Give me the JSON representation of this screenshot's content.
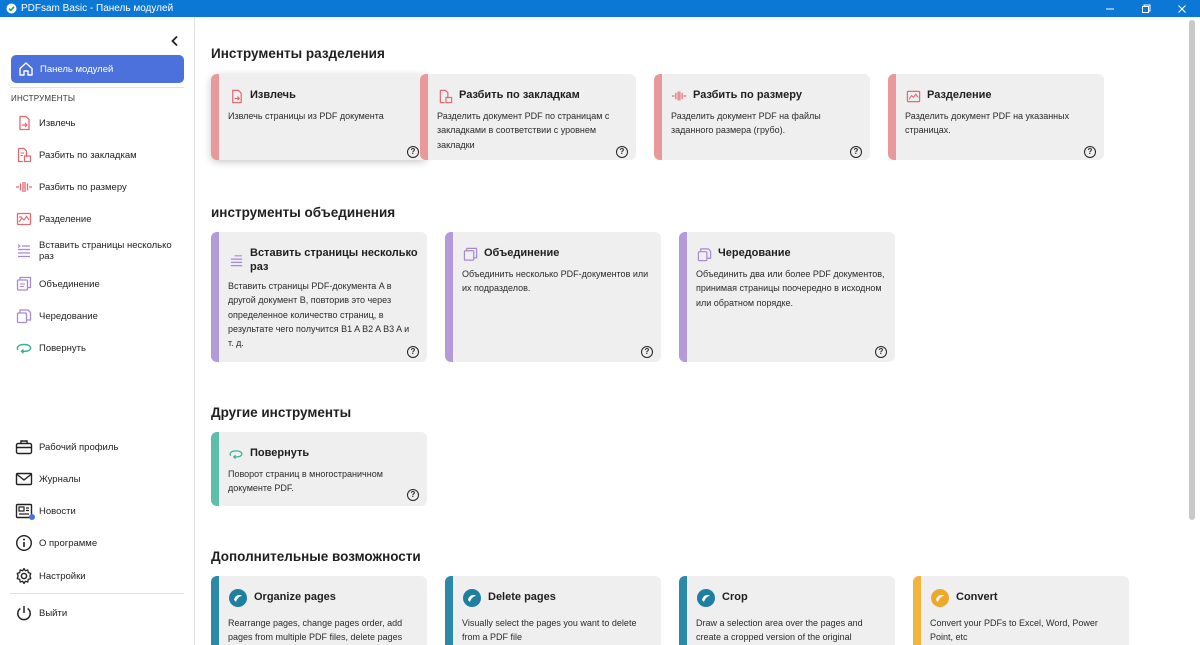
{
  "window": {
    "title": "PDFsam Basic - Панель модулей"
  },
  "sidebar": {
    "dashboard_label": "Панель модулей",
    "section_label": "ИНСТРУМЕНТЫ",
    "tools": [
      {
        "label": "Извлечь",
        "icon": "extract-icon"
      },
      {
        "label": "Разбить по закладкам",
        "icon": "split-bookmarks-icon"
      },
      {
        "label": "Разбить по размеру",
        "icon": "split-size-icon"
      },
      {
        "label": "Разделение",
        "icon": "split-icon"
      },
      {
        "label": "Вставить страницы несколько раз",
        "icon": "insert-pages-icon"
      },
      {
        "label": "Объединение",
        "icon": "merge-icon"
      },
      {
        "label": "Чередование",
        "icon": "alternate-mix-icon"
      },
      {
        "label": "Повернуть",
        "icon": "rotate-icon"
      }
    ],
    "bottom": [
      {
        "label": "Рабочий профиль",
        "icon": "workspace-icon"
      },
      {
        "label": "Журналы",
        "icon": "logs-icon"
      },
      {
        "label": "Новости",
        "icon": "news-icon"
      },
      {
        "label": "О программе",
        "icon": "info-icon"
      },
      {
        "label": "Настройки",
        "icon": "settings-icon"
      }
    ],
    "exit_label": "Выйти"
  },
  "sections": {
    "split": {
      "title": "Инструменты разделения",
      "cards": [
        {
          "title": "Извлечь",
          "desc": "Извлечь страницы из PDF документа"
        },
        {
          "title": "Разбить по закладкам",
          "desc": "Разделить документ PDF по страницам с закладками в соответствии с уровнем закладки"
        },
        {
          "title": "Разбить по размеру",
          "desc": "Разделить документ PDF на файлы заданного размера (грубо)."
        },
        {
          "title": "Разделение",
          "desc": "Разделить документ PDF на указанных страницах."
        }
      ]
    },
    "merge": {
      "title": "инструменты объединения",
      "cards": [
        {
          "title": "Вставить страницы несколько раз",
          "desc": "Вставить страницы PDF-документа A в другой документ B, повторив это через определенное количество страниц, в результате чего получится B1 A B2 A B3 A и т. д."
        },
        {
          "title": "Объединение",
          "desc": "Объединить несколько PDF-документов или их подразделов."
        },
        {
          "title": "Чередование",
          "desc": "Объединить два или более PDF документов, принимая страницы поочередно в исходном или обратном порядке."
        }
      ]
    },
    "other": {
      "title": "Другие инструменты",
      "cards": [
        {
          "title": "Повернуть",
          "desc": "Поворот страниц в многостраничном документе PDF."
        }
      ]
    },
    "extra": {
      "title": "Дополнительные возможности",
      "cards": [
        {
          "title": "Organize pages",
          "desc": "Rearrange pages, change pages order, add pages from multiple PDF files, delete pages"
        },
        {
          "title": "Delete pages",
          "desc": "Visually select the pages you want to delete from a PDF file"
        },
        {
          "title": "Crop",
          "desc": "Draw a selection area over the pages and create a cropped version of the original"
        },
        {
          "title": "Convert",
          "desc": "Convert your PDFs to Excel, Word, Power Point, etc"
        }
      ]
    }
  },
  "help_glyph": "?",
  "colors": {
    "titlebar": "#0a78d4",
    "accent": "#4d71dc",
    "split_bar": "#e9999b",
    "merge_bar": "#b49ad8",
    "other_bar": "#5bbfa9",
    "extra_bar": "#2c8aa8",
    "convert_bar": "#f3b43d"
  }
}
